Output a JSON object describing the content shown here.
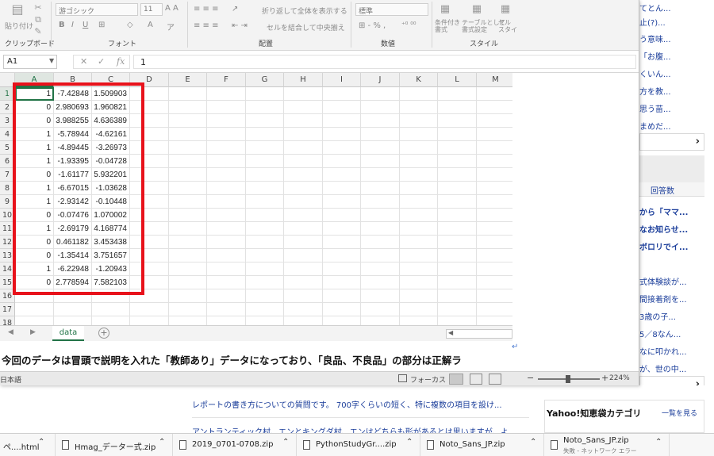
{
  "background_page": {
    "right_links": [
      {
        "text": "止(?)...",
        "bold": false
      },
      {
        "text": "う意味...",
        "bold": false
      },
      {
        "text": "「お腹...",
        "bold": false
      },
      {
        "text": "くいん...",
        "bold": false
      },
      {
        "text": "方を教...",
        "bold": false
      },
      {
        "text": "思う苗...",
        "bold": false
      },
      {
        "text": "まめだ...",
        "bold": false
      },
      {
        "text": "てとん...",
        "bold": false
      }
    ],
    "answers_header": "回答数",
    "ranking_links": [
      {
        "text": "から「ママ...",
        "bold": true
      },
      {
        "text": "なお知らせ...",
        "bold": true
      },
      {
        "text": "ボロリでイ...",
        "bold": true
      }
    ],
    "more_links": [
      {
        "text": "式体験談が..."
      },
      {
        "text": "間接着剤を..."
      },
      {
        "text": "3歳の子..."
      },
      {
        "text": "5／8なん..."
      },
      {
        "text": "なに叩かれ..."
      },
      {
        "text": "が、世の中..."
      }
    ],
    "questions": [
      "レポートの書き方についての質問です。 700字くらいの短く、特に複数の項目を設け...",
      "アントランティック村、エンとキングダ村、エンはどちらも形があるとは思いますが、よ..."
    ],
    "category_box": {
      "title": "Yahoo!知恵袋カテゴリ",
      "link": "一覧を見る"
    }
  },
  "excel": {
    "ribbon": {
      "clipboard_label": "クリップボード",
      "paste_label": "貼り付け",
      "font_label": "フォント",
      "font_name": "游ゴシック",
      "font_size": "11",
      "alignment_label": "配置",
      "wrap_text": "折り返して全体を表示する",
      "merge_center": "セルを結合して中央揃え",
      "number_label": "数値",
      "number_format": "標準",
      "styles_label": "スタイル",
      "conditional_format": "条件付き\n書式",
      "table_format": "テーブルとして\n書式設定",
      "cell_styles": "セル\nスタイ"
    },
    "name_box": "A1",
    "formula_value": "1",
    "columns": [
      "A",
      "B",
      "C",
      "D",
      "E",
      "F",
      "G",
      "H",
      "I",
      "J",
      "K",
      "L",
      "M"
    ],
    "row_numbers": [
      "1",
      "2",
      "3",
      "4",
      "5",
      "6",
      "7",
      "8",
      "9",
      "10",
      "11",
      "12",
      "13",
      "14",
      "15",
      "16",
      "17",
      "18"
    ],
    "rows": [
      [
        "1",
        "-7.42848",
        "1.509903"
      ],
      [
        "0",
        "2.980693",
        "1.960821"
      ],
      [
        "0",
        "3.988255",
        "4.636389"
      ],
      [
        "1",
        "-5.78944",
        "-4.62161"
      ],
      [
        "1",
        "-4.89445",
        "-3.26973"
      ],
      [
        "1",
        "-1.93395",
        "-0.04728"
      ],
      [
        "0",
        "-1.61177",
        "5.932201"
      ],
      [
        "1",
        "-6.67015",
        "-1.03628"
      ],
      [
        "1",
        "-2.93142",
        "-0.10448"
      ],
      [
        "0",
        "-0.07476",
        "1.070002"
      ],
      [
        "1",
        "-2.69179",
        "4.168774"
      ],
      [
        "0",
        "0.461182",
        "3.453438"
      ],
      [
        "0",
        "-1.35414",
        "3.751657"
      ],
      [
        "1",
        "-6.22948",
        "-1.20943"
      ],
      [
        "0",
        "2.778594",
        "7.582103"
      ]
    ],
    "sheet_tab": "data",
    "doc_text": "今回のデータは冒頭で説明を入れた「教師あり」データになっており、「良品、不良品」の部分は正解ラ",
    "status": {
      "language": "日本語",
      "focus_mode": "フォーカス",
      "zoom": "224%"
    },
    "highlight_color": "#e8121b",
    "accent_color": "#217346"
  },
  "downloads": [
    {
      "name": "ぺ....html",
      "sub": ""
    },
    {
      "name": "Hmag_データー式.zip",
      "sub": ""
    },
    {
      "name": "2019_0701-0708.zip",
      "sub": ""
    },
    {
      "name": "PythonStudyGr....zip",
      "sub": ""
    },
    {
      "name": "Noto_Sans_JP.zip",
      "sub": ""
    },
    {
      "name": "Noto_Sans_JP.zip",
      "sub": "失敗 - ネットワーク エラー"
    }
  ]
}
